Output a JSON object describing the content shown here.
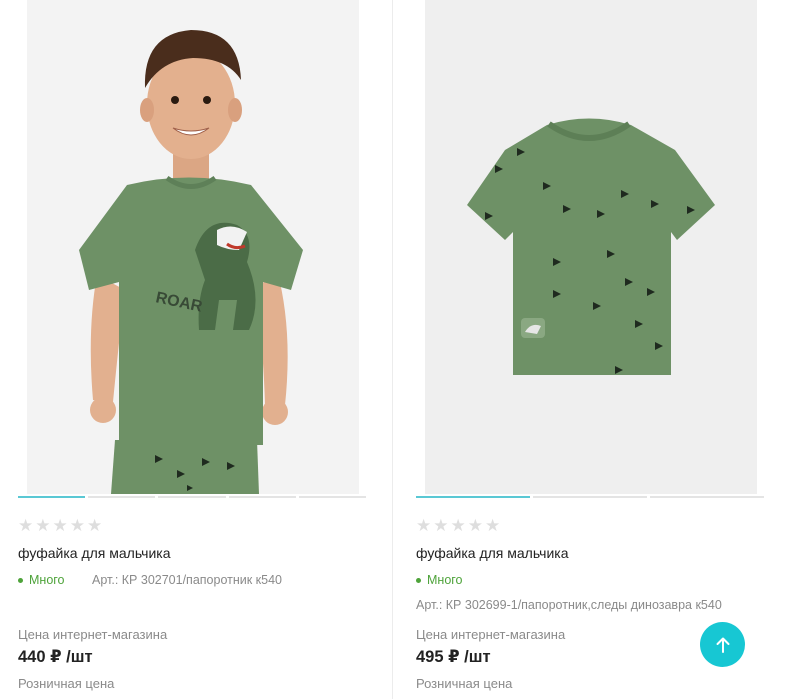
{
  "products": [
    {
      "rating_stars": "★★★★★",
      "title": "фуфайка для мальчика",
      "stock": "Много",
      "article": "Арт.: КР 302701/папоротник к540",
      "price_label": "Цена интернет-магазина",
      "price": "440 ₽ /шт",
      "retail_label": "Розничная цена",
      "print_text": "ROAR",
      "gallery_count": 5,
      "gallery_active": 1
    },
    {
      "rating_stars": "★★★★★",
      "title": "фуфайка для мальчика",
      "stock": "Много",
      "article": "Арт.: КР 302699-1/папоротник,следы динозавра к540",
      "price_label": "Цена интернет-магазина",
      "price": "495 ₽ /шт",
      "retail_label": "Розничная цена",
      "gallery_count": 3,
      "gallery_active": 1
    }
  ],
  "colors": {
    "accent": "#17c7d3",
    "stock_green": "#4ea33a",
    "shirt_green": "#6e9166"
  },
  "icons": {
    "scroll_top": "arrow-up-icon",
    "rating": "star-icon"
  }
}
